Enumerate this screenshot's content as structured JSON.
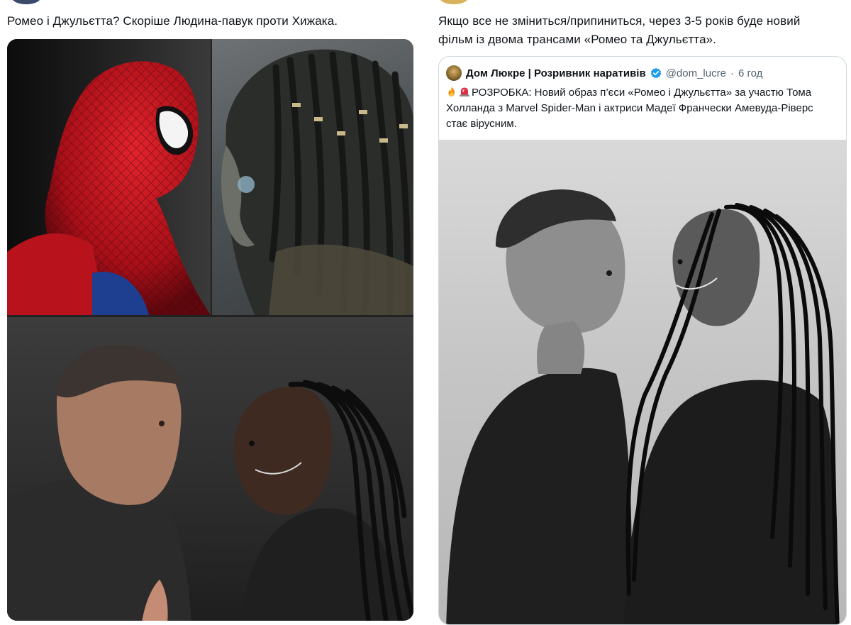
{
  "left_tweet": {
    "text": "Ромео і Джульєтта? Скоріше Людина-павук проти Хижака.",
    "media": {
      "panels": [
        "spider-man-mask",
        "predator-mask",
        "rehearsal-photo-color"
      ]
    }
  },
  "right_tweet": {
    "text": "Якщо все не зміниться/припиниться, через 3-5 років буде новий фільм із двома трансами «Ромео та Джульєтта».",
    "quote": {
      "author_name": "Дом Люкре | Розривник наративів",
      "handle": "@dom_lucre",
      "separator": "·",
      "time": "6 год",
      "verified": true,
      "emojis": [
        "fire-icon",
        "siren-icon"
      ],
      "body": "РОЗРОБКА: Новий образ п’єси «Ромео і Джульєтта» за участю Тома Холланда з Marvel Spider-Man і актриси Мадеї Франчески Амевуда-Ріверс стає вірусним.",
      "media": "rehearsal-photo-bw"
    }
  },
  "colors": {
    "text": "#0f1419",
    "secondary": "#536471",
    "border": "#cfd9de",
    "verified": "#1d9bf0",
    "spider_red": "#c0141e",
    "spider_blue": "#1e3f8f"
  }
}
